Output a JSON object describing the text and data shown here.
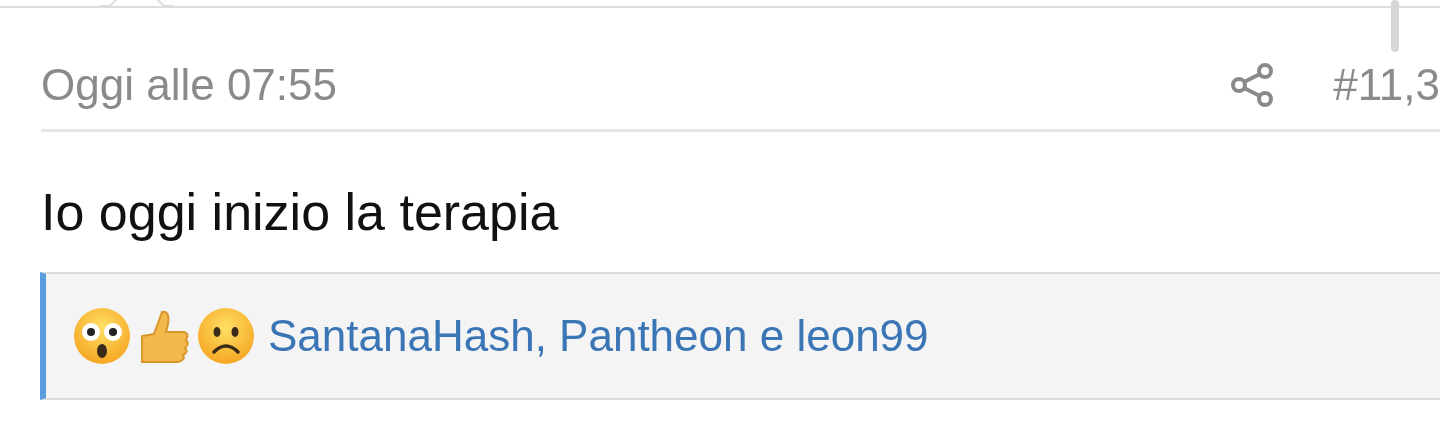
{
  "post": {
    "time": "Oggi alle 07:55",
    "number": "#11,3",
    "body": "Io oggi inizio la terapia"
  },
  "reactions": {
    "emojis": [
      {
        "kind": "astonished"
      },
      {
        "kind": "thumbs_up"
      },
      {
        "kind": "frown"
      }
    ],
    "users": "SantanaHash, Pantheon e leon99"
  }
}
